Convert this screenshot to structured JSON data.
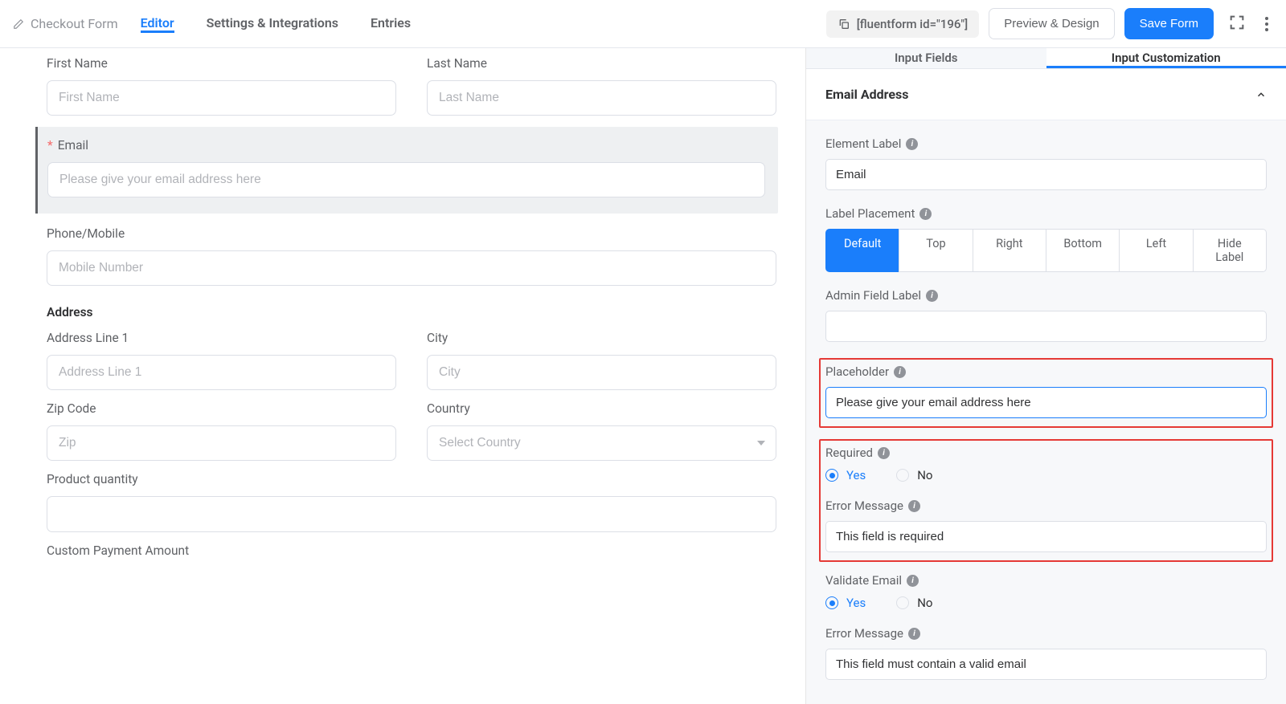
{
  "header": {
    "form_title": "Checkout Form",
    "tabs": {
      "editor": "Editor",
      "settings": "Settings & Integrations",
      "entries": "Entries"
    },
    "shortcode": "[fluentform id=\"196\"]",
    "preview_btn": "Preview & Design",
    "save_btn": "Save Form"
  },
  "form": {
    "first_name": {
      "label": "First Name",
      "placeholder": "First Name"
    },
    "last_name": {
      "label": "Last Name",
      "placeholder": "Last Name"
    },
    "email": {
      "label": "Email",
      "placeholder": "Please give your email address here"
    },
    "phone": {
      "label": "Phone/Mobile",
      "placeholder": "Mobile Number"
    },
    "address_heading": "Address",
    "addr1": {
      "label": "Address Line 1",
      "placeholder": "Address Line 1"
    },
    "city": {
      "label": "City",
      "placeholder": "City"
    },
    "zip": {
      "label": "Zip Code",
      "placeholder": "Zip"
    },
    "country": {
      "label": "Country",
      "placeholder": "Select Country"
    },
    "qty": {
      "label": "Product quantity"
    },
    "payment": {
      "label": "Custom Payment Amount"
    }
  },
  "side": {
    "tabs": {
      "fields": "Input Fields",
      "custom": "Input Customization"
    },
    "section_title": "Email Address",
    "element_label": {
      "label": "Element Label",
      "value": "Email"
    },
    "label_placement": {
      "label": "Label Placement",
      "options": {
        "default": "Default",
        "top": "Top",
        "right": "Right",
        "bottom": "Bottom",
        "left": "Left",
        "hide": "Hide Label"
      }
    },
    "admin_label": {
      "label": "Admin Field Label",
      "value": ""
    },
    "placeholder": {
      "label": "Placeholder",
      "value": "Please give your email address here"
    },
    "required": {
      "label": "Required",
      "yes": "Yes",
      "no": "No"
    },
    "error_msg": {
      "label": "Error Message",
      "value": "This field is required"
    },
    "validate_email": {
      "label": "Validate Email",
      "yes": "Yes",
      "no": "No"
    },
    "error_msg2": {
      "label": "Error Message",
      "value": "This field must contain a valid email"
    }
  }
}
